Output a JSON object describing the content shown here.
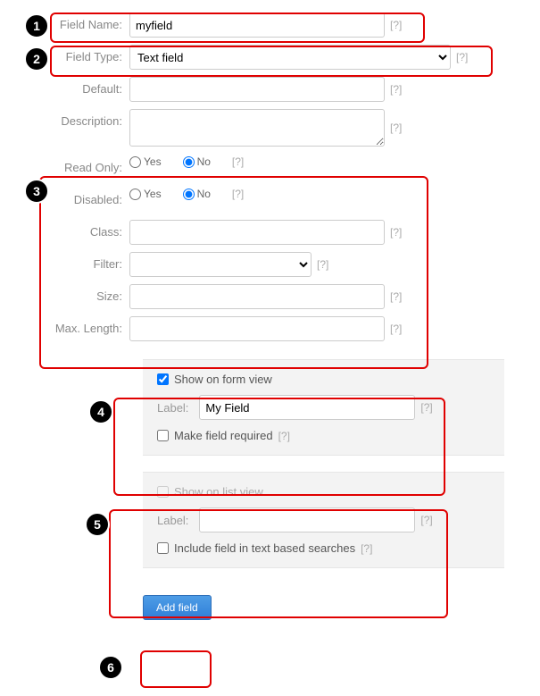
{
  "form": {
    "field_name_label": "Field Name:",
    "field_name_value": "myfield",
    "field_type_label": "Field Type:",
    "field_type_value": "Text field",
    "default_label": "Default:",
    "default_value": "",
    "description_label": "Description:",
    "description_value": "",
    "read_only_label": "Read Only:",
    "disabled_label": "Disabled:",
    "yes_label": "Yes",
    "no_label": "No",
    "class_label": "Class:",
    "class_value": "",
    "filter_label": "Filter:",
    "filter_value": "",
    "size_label": "Size:",
    "size_value": "",
    "max_length_label": "Max. Length:",
    "max_length_value": ""
  },
  "formview": {
    "show_label": "Show on form view",
    "show_checked": true,
    "label_label": "Label:",
    "label_value": "My Field",
    "required_label": "Make field required",
    "required_checked": false
  },
  "listview": {
    "show_label": "Show on list view",
    "show_checked": false,
    "label_label": "Label:",
    "label_value": "",
    "search_label": "Include field in text based searches",
    "search_checked": false
  },
  "buttons": {
    "add_field": "Add field"
  },
  "help": "[?]",
  "callouts": {
    "n1": "1",
    "n2": "2",
    "n3": "3",
    "n4": "4",
    "n5": "5",
    "n6": "6"
  }
}
